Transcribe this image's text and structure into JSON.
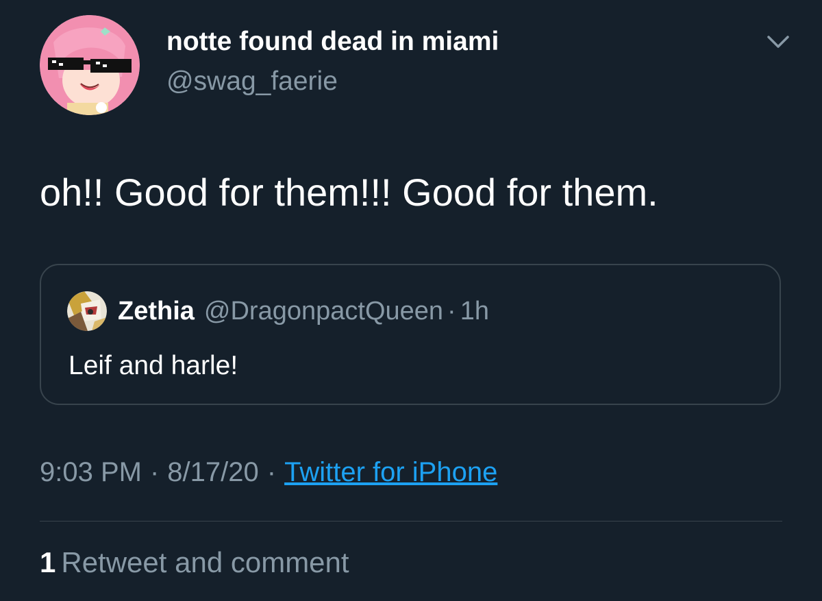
{
  "tweet": {
    "display_name": "notte found dead in miami",
    "handle": "@swag_faerie",
    "text": "oh!! Good for them!!! Good for them.",
    "menu_icon": "chevron-down-icon",
    "avatar_icon": "anime-avatar-sunglasses"
  },
  "quoted": {
    "display_name": "Zethia",
    "handle": "@DragonpactQueen",
    "separator": "·",
    "time": "1h",
    "text": "Leif and harle!"
  },
  "meta": {
    "time": "9:03 PM",
    "separator": "·",
    "date": "8/17/20",
    "source": "Twitter for iPhone"
  },
  "stats": {
    "count": "1",
    "label": "Retweet and comment"
  },
  "colors": {
    "background": "#15202b",
    "text": "#ffffff",
    "muted": "#8899a6",
    "link": "#1da1f2",
    "border": "#38444d"
  }
}
